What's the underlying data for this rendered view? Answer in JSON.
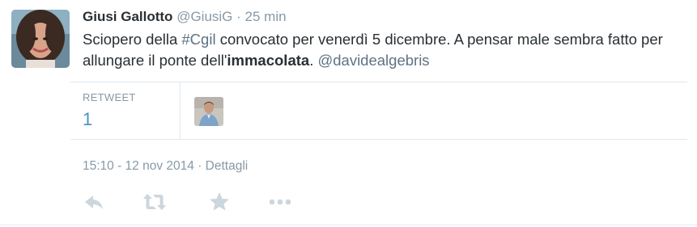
{
  "tweet": {
    "author": {
      "name": "Giusi Gallotto",
      "handle": "@GiusiG",
      "separator": "·",
      "time_ago": "25 min"
    },
    "text": {
      "part1": "Sciopero della ",
      "hashtag": "#Cgil",
      "part2": " convocato per venerdì 5 dicembre. A pensar male sembra fatto per allungare il ponte dell'",
      "strong": "immacolata",
      "part3": ". ",
      "mention": "@davidealgebris"
    },
    "stats": {
      "retweet_label": "RETWEET",
      "retweet_count": "1"
    },
    "meta": {
      "timestamp": "15:10 - 12 nov 2014",
      "separator": " · ",
      "details_label": "Dettagli"
    },
    "actions": [
      "reply-icon",
      "retweet-icon",
      "favorite-icon",
      "more-icon"
    ]
  },
  "colors": {
    "text": "#292f33",
    "muted": "#8899a6",
    "link": "#5f7284",
    "count": "#4a90c6",
    "divider": "#e1e8ed",
    "action_icon": "#ccd6dd"
  }
}
